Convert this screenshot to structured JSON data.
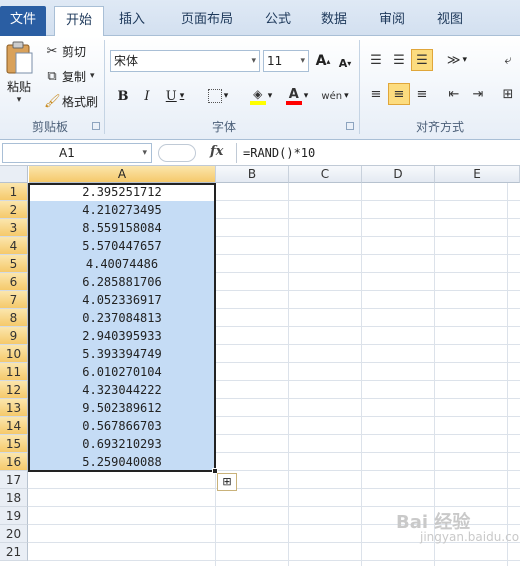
{
  "tabs": [
    "文件",
    "开始",
    "插入",
    "页面布局",
    "公式",
    "数据",
    "审阅",
    "视图"
  ],
  "clipboard": {
    "paste_label": "粘贴",
    "cut_label": "剪切",
    "copy_label": "复制",
    "format_painter_label": "格式刷",
    "group_label": "剪贴板"
  },
  "font": {
    "name": "宋体",
    "size": "11",
    "bold_icon": "B",
    "italic_icon": "I",
    "underline_icon": "U",
    "grow_icon": "A",
    "shrink_icon": "A",
    "fill_color": "#ffff00",
    "font_color": "#ff0000",
    "group_label": "字体"
  },
  "alignment": {
    "group_label": "对齐方式"
  },
  "formula_bar": {
    "name_box": "A1",
    "fx": "fx",
    "formula": "=RAND()*10"
  },
  "sheet": {
    "columns": [
      "A",
      "B",
      "C",
      "D",
      "E"
    ],
    "rows": [
      "1",
      "2",
      "3",
      "4",
      "5",
      "6",
      "7",
      "8",
      "9",
      "10",
      "11",
      "12",
      "13",
      "14",
      "15",
      "16",
      "17",
      "18",
      "19",
      "20",
      "21"
    ],
    "values": [
      "2.395251712",
      "4.210273495",
      "8.559158084",
      "5.570447657",
      "4.40074486",
      "6.285881706",
      "4.052336917",
      "0.237084813",
      "2.940395933",
      "5.393394749",
      "6.010270104",
      "4.323044222",
      "9.502389612",
      "0.567866703",
      "0.693210293",
      "5.259040088"
    ],
    "selection_color": "#c5dcf5",
    "header_highlight": "#f5c96b"
  },
  "watermark": {
    "brand": "Bai 经验",
    "url": "jingyan.baidu.com"
  }
}
